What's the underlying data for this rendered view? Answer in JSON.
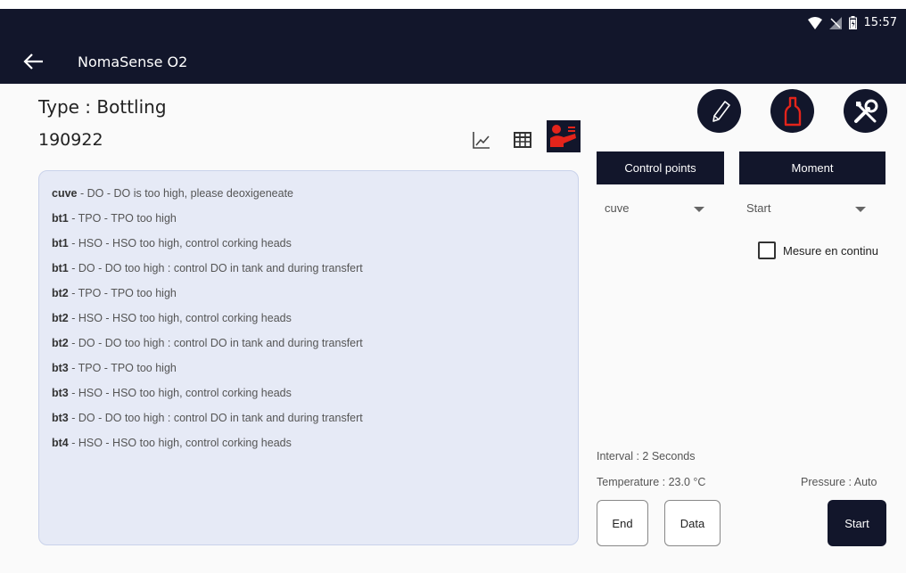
{
  "status_bar": {
    "time": "15:57",
    "icons": [
      "wifi-icon",
      "no-signal-icon",
      "battery-icon"
    ]
  },
  "app_bar": {
    "title": "NomaSense O2",
    "back_icon": "arrow-left-icon"
  },
  "header": {
    "type_label": "Type : Bottling",
    "code": "190922"
  },
  "view_icons": [
    "chart-icon",
    "table-icon",
    "alert-list-icon"
  ],
  "messages": [
    {
      "point": "cuve",
      "text": " - DO - DO is too high, please deoxigeneate"
    },
    {
      "point": "bt1",
      "text": " - TPO - TPO too high"
    },
    {
      "point": "bt1",
      "text": " - HSO - HSO too high, control corking heads"
    },
    {
      "point": "bt1",
      "text": " - DO - DO too high : control DO in tank and during transfert"
    },
    {
      "point": "bt2",
      "text": " - TPO - TPO too high"
    },
    {
      "point": "bt2",
      "text": " - HSO - HSO too high, control corking heads"
    },
    {
      "point": "bt2",
      "text": " - DO - DO too high : control DO in tank and during transfert"
    },
    {
      "point": "bt3",
      "text": " - TPO - TPO too high"
    },
    {
      "point": "bt3",
      "text": " - HSO - HSO too high, control corking heads"
    },
    {
      "point": "bt3",
      "text": " - DO - DO too high : control DO in tank and during transfert"
    },
    {
      "point": "bt4",
      "text": " - HSO - HSO too high, control corking heads"
    }
  ],
  "tool_icons": [
    "pencil-icon",
    "bottle-icon",
    "tools-icon"
  ],
  "controls": {
    "control_points_label": "Control points",
    "moment_label": "Moment",
    "control_point_value": "cuve",
    "moment_value": "Start",
    "continuous_label": "Mesure en continu",
    "continuous_checked": false
  },
  "info": {
    "interval": "Interval : 2 Seconds",
    "temperature": "Temperature : 23.0 °C",
    "pressure": "Pressure : Auto"
  },
  "buttons": {
    "end": "End",
    "data": "Data",
    "start": "Start"
  },
  "colors": {
    "primary": "#12162b",
    "accent_red": "#e3241b",
    "panel_bg": "#e6eaf6"
  }
}
